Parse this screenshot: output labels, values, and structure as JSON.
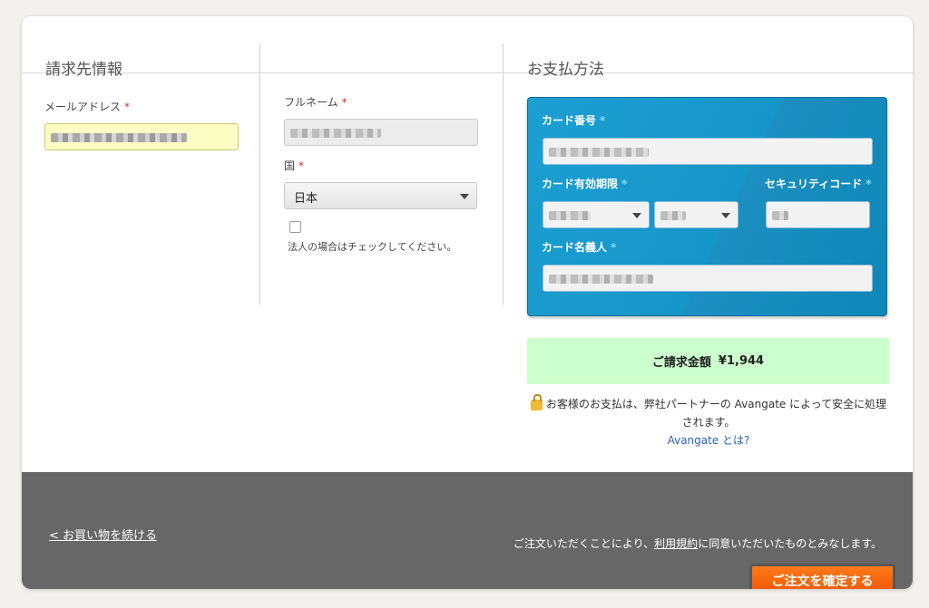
{
  "billing": {
    "title": "請求先情報",
    "email_label": "メールアドレス",
    "fullname_label": "フルネーム",
    "country_label": "国",
    "country_value": "日本",
    "corporate_note": "法人の場合はチェックしてください。",
    "required_mark": "*"
  },
  "payment": {
    "title": "お支払方法",
    "card_number_label": "カード番号",
    "expiry_label": "カード有効期限",
    "security_code_label": "セキュリティコード",
    "cardholder_label": "カード名義人",
    "required_mark": "*"
  },
  "total": {
    "label": "ご請求金額",
    "amount": "¥1,944"
  },
  "secure_note": {
    "text": "お客様のお支払は、弊社パートナーの Avangate によって安全に処理されます。",
    "link": "Avangate とは?"
  },
  "footer": {
    "back_link": "< お買い物を続ける",
    "terms_prefix": "ご注文いただくことにより、",
    "terms_link": "利用規約",
    "terms_suffix": "に同意いただいたものとみなします。",
    "confirm_button": "ご注文を確定する"
  },
  "colors": {
    "accent_orange": "#ff6a10",
    "payment_blue": "#1695c8",
    "total_green": "#cdfecd",
    "email_highlight": "#fbfdc3"
  }
}
